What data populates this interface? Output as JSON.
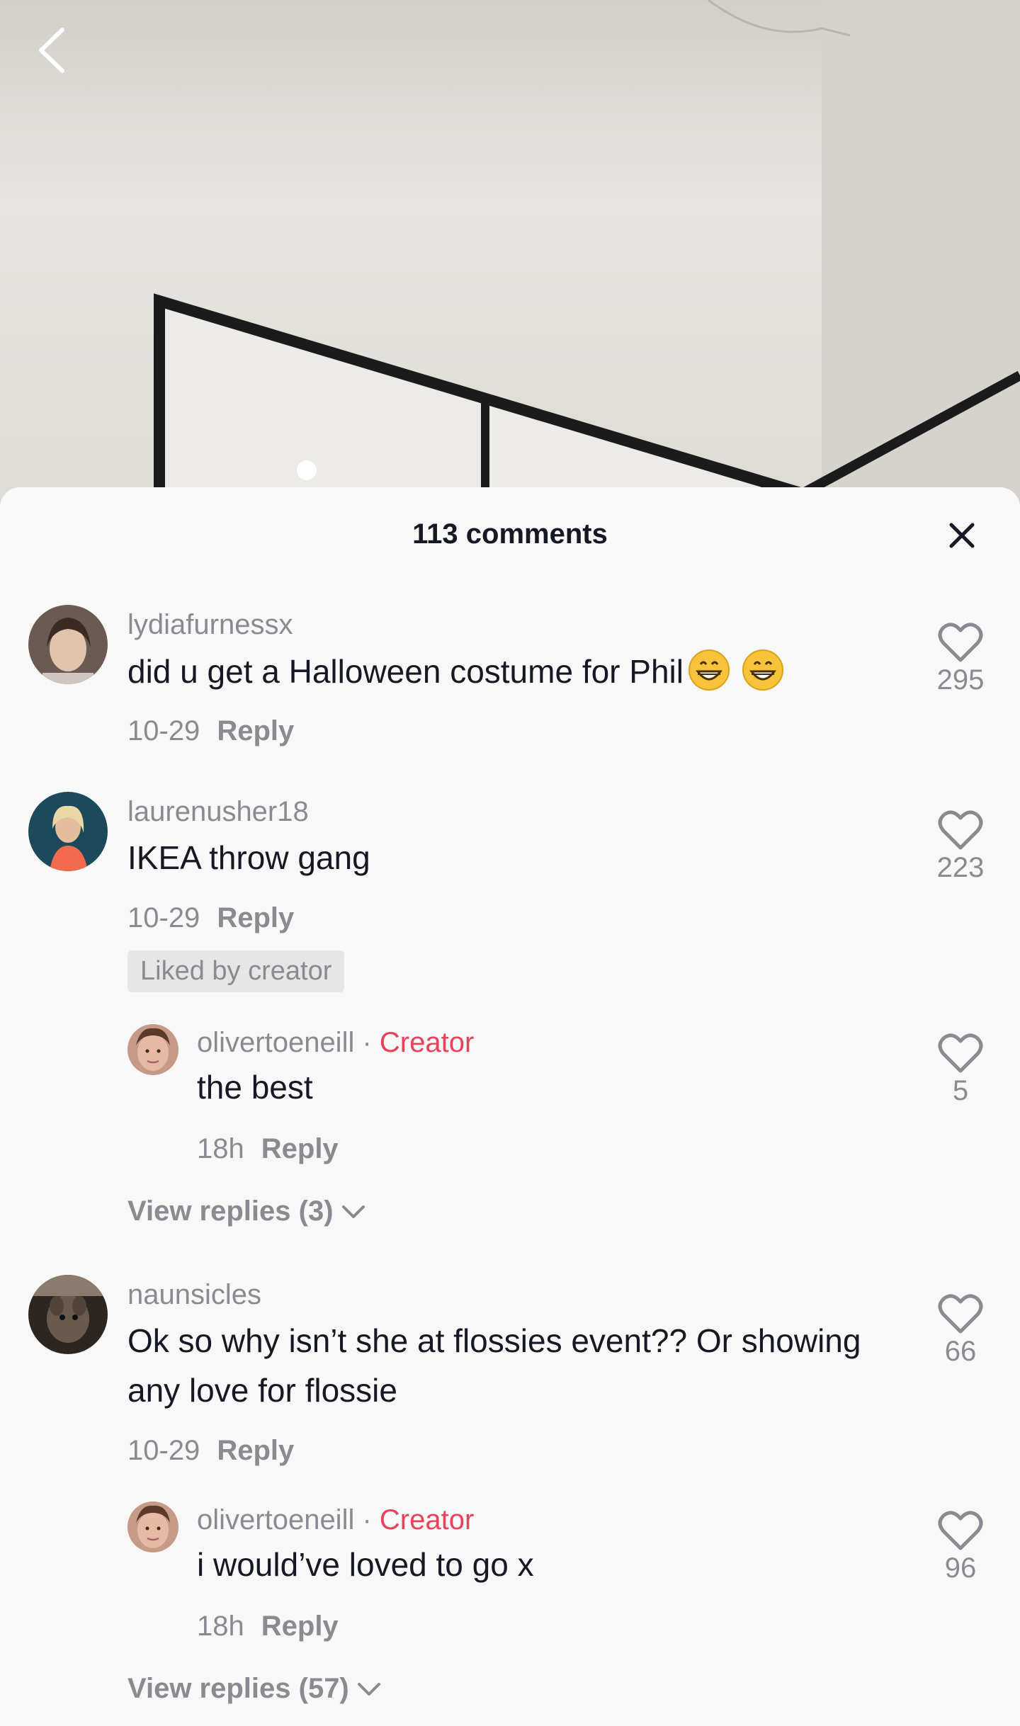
{
  "colors": {
    "accent_creator": "#e8435a",
    "text_primary": "#161823",
    "text_secondary": "#8a8b91",
    "sheet_bg": "#f8f8f8"
  },
  "header": {
    "back_icon": "chevron-left-icon",
    "title": "113 comments",
    "close_icon": "close-icon"
  },
  "comments": [
    {
      "username": "lydiafurnessx",
      "text": "did u get a Halloween costume for Phil",
      "emoji": "grinning-face-emoji x2",
      "date": "10-29",
      "reply": "Reply",
      "likes": "295"
    },
    {
      "username": "laurenusher18",
      "text": "IKEA throw gang",
      "date": "10-29",
      "reply": "Reply",
      "likes": "223",
      "badge": "Liked by creator",
      "replies": [
        {
          "username": "olivertoeneill",
          "separator": "·",
          "tag": "Creator",
          "text": "the best",
          "date": "18h",
          "reply": "Reply",
          "likes": "5"
        }
      ],
      "view_replies": "View replies (3)"
    },
    {
      "username": "naunsicles",
      "text": "Ok so why isn’t she at flossies event?? Or showing any love for flossie",
      "date": "10-29",
      "reply": "Reply",
      "likes": "66",
      "replies": [
        {
          "username": "olivertoeneill",
          "separator": "·",
          "tag": "Creator",
          "text": "i would’ve loved to go x",
          "date": "18h",
          "reply": "Reply",
          "likes": "96"
        }
      ],
      "view_replies": "View replies (57)"
    }
  ]
}
